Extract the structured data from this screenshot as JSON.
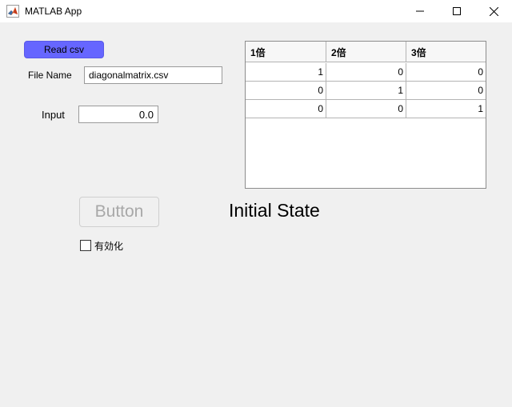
{
  "window": {
    "title": "MATLAB App",
    "icon": "matlab-icon",
    "controls": [
      "minimize-icon",
      "maximize-icon",
      "close-icon"
    ]
  },
  "read_button": {
    "label": "Read csv",
    "color": "#6666ff"
  },
  "file_name": {
    "label": "File Name",
    "value": "diagonalmatrix.csv"
  },
  "input": {
    "label": "Input",
    "value": "0.0"
  },
  "table": {
    "headers": [
      "1倍",
      "2倍",
      "3倍"
    ],
    "rows": [
      [
        "1",
        "0",
        "0"
      ],
      [
        "0",
        "1",
        "0"
      ],
      [
        "0",
        "0",
        "1"
      ]
    ]
  },
  "button": {
    "label": "Button",
    "enabled": false
  },
  "status": {
    "text": "Initial State"
  },
  "checkbox": {
    "label": "有効化",
    "checked": false
  }
}
